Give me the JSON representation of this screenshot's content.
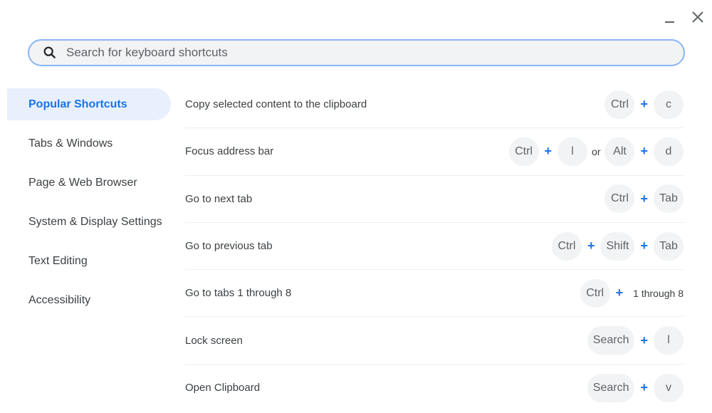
{
  "window": {
    "minimize_icon": "minimize-icon",
    "close_icon": "close-icon"
  },
  "search": {
    "placeholder": "Search for keyboard shortcuts",
    "value": ""
  },
  "sidebar": {
    "items": [
      {
        "label": "Popular Shortcuts",
        "active": true
      },
      {
        "label": "Tabs & Windows"
      },
      {
        "label": "Page & Web Browser"
      },
      {
        "label": "System & Display Settings"
      },
      {
        "label": "Text Editing"
      },
      {
        "label": "Accessibility"
      }
    ]
  },
  "shortcuts": [
    {
      "description": "Copy selected content to the clipboard",
      "keys": [
        {
          "k": "Ctrl"
        },
        {
          "p": "+"
        },
        {
          "k": "c"
        }
      ]
    },
    {
      "description": "Focus address bar",
      "keys": [
        {
          "k": "Ctrl"
        },
        {
          "p": "+"
        },
        {
          "k": "l"
        },
        {
          "t": "or"
        },
        {
          "k": "Alt"
        },
        {
          "p": "+"
        },
        {
          "k": "d"
        }
      ]
    },
    {
      "description": "Go to next tab",
      "keys": [
        {
          "k": "Ctrl"
        },
        {
          "p": "+"
        },
        {
          "k": "Tab"
        }
      ]
    },
    {
      "description": "Go to previous tab",
      "keys": [
        {
          "k": "Ctrl"
        },
        {
          "p": "+"
        },
        {
          "k": "Shift"
        },
        {
          "p": "+"
        },
        {
          "k": "Tab"
        }
      ]
    },
    {
      "description": "Go to tabs 1 through 8",
      "keys": [
        {
          "k": "Ctrl"
        },
        {
          "p": "+"
        },
        {
          "t": "1 through 8"
        }
      ]
    },
    {
      "description": "Lock screen",
      "keys": [
        {
          "k": "Search"
        },
        {
          "p": "+"
        },
        {
          "k": "l"
        }
      ]
    },
    {
      "description": "Open Clipboard",
      "keys": [
        {
          "k": "Search"
        },
        {
          "p": "+"
        },
        {
          "k": "v"
        }
      ]
    }
  ],
  "colors": {
    "accent": "#1a73e8",
    "key_bg": "#f1f3f4",
    "active_bg": "#e8f0fe"
  }
}
